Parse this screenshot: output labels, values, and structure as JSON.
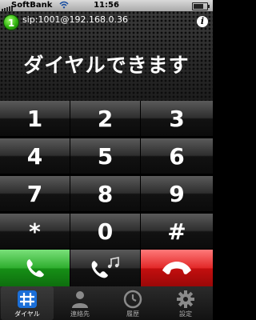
{
  "statusbar": {
    "carrier": "SoftBank",
    "time": "11:56"
  },
  "account": {
    "index": "1",
    "sip": "sip:1001@192.168.0.36"
  },
  "display": {
    "message": "ダイヤルできます"
  },
  "keypad": [
    "1",
    "2",
    "3",
    "4",
    "5",
    "6",
    "7",
    "8",
    "9",
    "*",
    "0",
    "#"
  ],
  "tabs": [
    {
      "label": "ダイヤル",
      "icon": "keypad-icon",
      "active": true
    },
    {
      "label": "連絡先",
      "icon": "contacts-icon",
      "active": false
    },
    {
      "label": "履歴",
      "icon": "history-clock-icon",
      "active": false
    },
    {
      "label": "設定",
      "icon": "settings-gear-icon",
      "active": false
    }
  ],
  "colors": {
    "call": "#2fae2f",
    "hangup": "#e22828",
    "status_dot": "#2fb10e"
  }
}
